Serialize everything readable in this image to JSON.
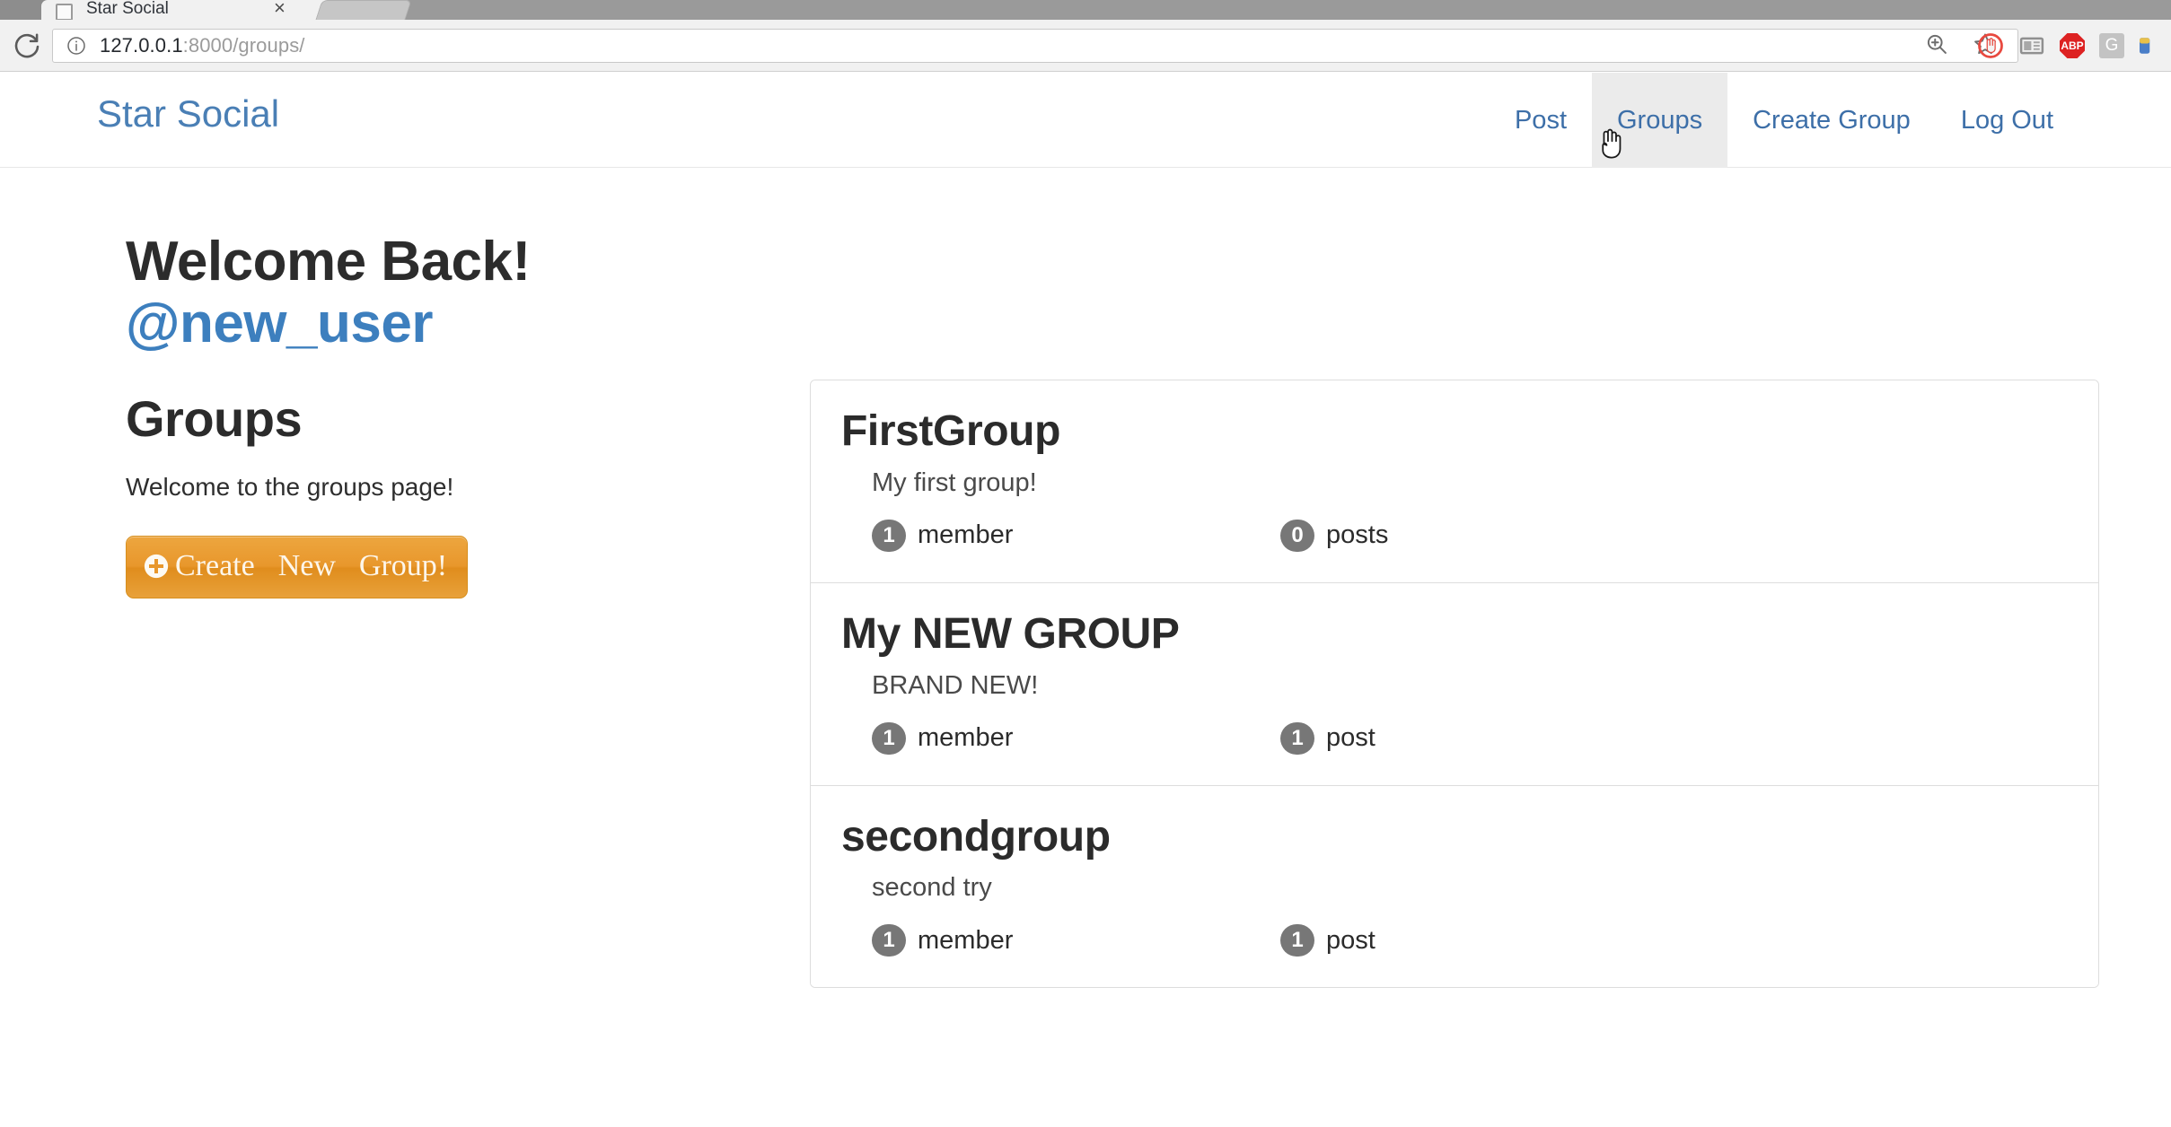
{
  "browser": {
    "tab_title": "Star Social",
    "tab_close_glyph": "×",
    "url_host": "127.0.0.1",
    "url_path": ":8000/groups/",
    "reload_icon": "reload-icon",
    "info_icon": "page-info-icon",
    "zoom_icon": "zoom-in-icon",
    "bookmark_icon": "star-bookmark-icon",
    "extensions": [
      {
        "name": "blocker-extension-icon",
        "label": ""
      },
      {
        "name": "reader-view-extension-icon",
        "label": ""
      },
      {
        "name": "adblock-plus-extension-icon",
        "label": "ABP"
      },
      {
        "name": "google-extension-icon",
        "label": "G"
      }
    ]
  },
  "navbar": {
    "brand": "Star Social",
    "links": [
      {
        "label": "Post",
        "name": "nav-post",
        "active": false
      },
      {
        "label": "Groups",
        "name": "nav-groups",
        "active": true
      },
      {
        "label": "Create Group",
        "name": "nav-create-group",
        "active": false
      },
      {
        "label": "Log Out",
        "name": "nav-log-out",
        "active": false
      }
    ]
  },
  "sidebar": {
    "welcome_heading": "Welcome Back!",
    "handle": "@new_user",
    "section_heading": "Groups",
    "section_subtitle": "Welcome to the groups page!",
    "create_button": {
      "icon": "plus-circle-icon",
      "word1": "Create",
      "word2": "New",
      "word3": "Group!"
    }
  },
  "groups": [
    {
      "title": "FirstGroup",
      "description": "My first group!",
      "member_count": "1",
      "member_label": "member",
      "post_count": "0",
      "post_label": "posts"
    },
    {
      "title": "My NEW GROUP",
      "description": "BRAND NEW!",
      "member_count": "1",
      "member_label": "member",
      "post_count": "1",
      "post_label": "post"
    },
    {
      "title": "secondgroup",
      "description": "second try",
      "member_count": "1",
      "member_label": "member",
      "post_count": "1",
      "post_label": "post"
    }
  ],
  "colors": {
    "brand_blue": "#4a7fb5",
    "link_blue": "#3d7fbe",
    "button_orange": "#e8972c",
    "badge_gray": "#777777",
    "active_nav_bg": "#ebebeb"
  }
}
